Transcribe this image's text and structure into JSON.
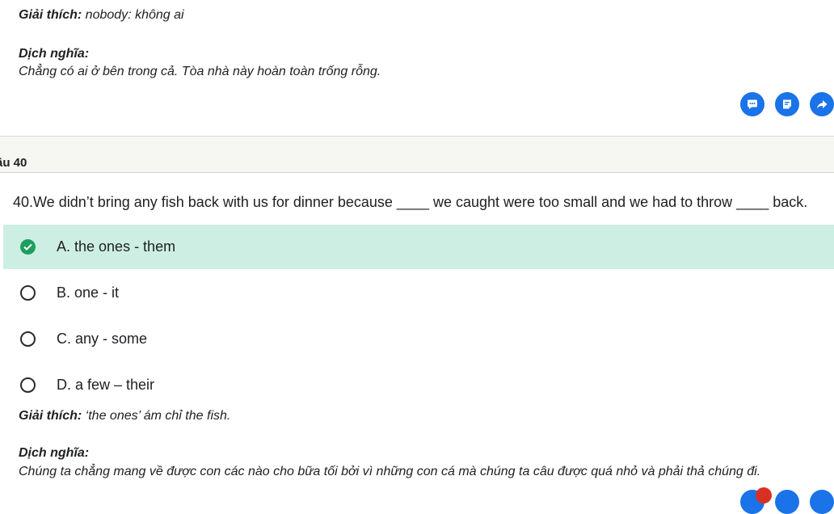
{
  "prev_explanation": {
    "label": "Giải thích:",
    "text": " nobody: không ai",
    "translation_label": "Dịch nghĩa:",
    "translation": "Chẳng có ai ở bên trong cả. Tòa nhà này hoàn toàn trống rỗng."
  },
  "actions": [
    {
      "icon": "comment-icon"
    },
    {
      "icon": "note-icon"
    },
    {
      "icon": "share-icon"
    }
  ],
  "question": {
    "number_label": "âu 40",
    "text": "40.We didn’t bring any fish back with us for dinner because ____ we caught were too small and we had to throw ____ back.",
    "options": [
      {
        "label": "A. the ones - them",
        "correct": true
      },
      {
        "label": "B. one - it",
        "correct": false
      },
      {
        "label": "C. any - some",
        "correct": false
      },
      {
        "label": "D. a few – their",
        "correct": false
      }
    ],
    "explanation_label": "Giải thích:",
    "explanation_text": " ‘the ones’ ám chỉ the fish.",
    "translation_label": "Dịch nghĩa:",
    "translation": "Chúng ta chẳng mang về được con các nào cho bữa tối bởi vì những con cá mà chúng ta câu được quá nhỏ và phải thả chúng đi."
  },
  "colors": {
    "accent": "#1a73e8",
    "correct_bg": "#cdefe3",
    "correct_check": "#1e9e5e"
  }
}
